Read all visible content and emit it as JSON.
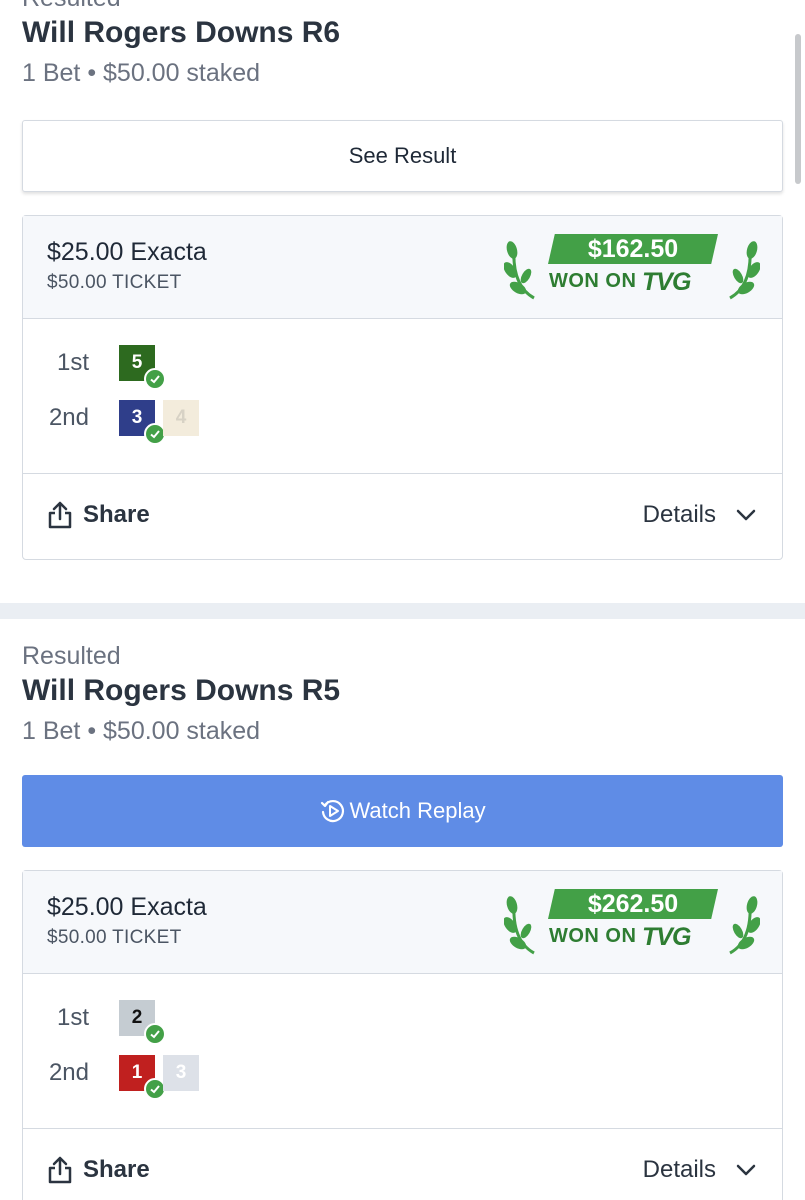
{
  "sections": [
    {
      "status": "Resulted",
      "title": "Will Rogers Downs R6",
      "summary": "1 Bet • $50.00 staked",
      "action_label": "See Result",
      "ticket": {
        "bet": "$25.00 Exacta",
        "ticket_cost": "$50.00 TICKET",
        "won_amount": "$162.50",
        "won_label": "WON ON",
        "won_brand": "TVG",
        "positions": [
          {
            "label": "1st",
            "runners": [
              {
                "number": "5",
                "bg": "#2d6a1f",
                "fg": "#ffffff",
                "winner": true
              }
            ]
          },
          {
            "label": "2nd",
            "runners": [
              {
                "number": "3",
                "bg": "#2f3e8a",
                "fg": "#ffffff",
                "winner": true
              },
              {
                "number": "4",
                "bg": "#f3ecdc",
                "fg": "#d7d2c5",
                "winner": false
              }
            ]
          }
        ],
        "share_label": "Share",
        "details_label": "Details"
      }
    },
    {
      "status": "Resulted",
      "title": "Will Rogers Downs R5",
      "summary": "1 Bet • $50.00 staked",
      "action_label": "Watch Replay",
      "ticket": {
        "bet": "$25.00 Exacta",
        "ticket_cost": "$50.00 TICKET",
        "won_amount": "$262.50",
        "won_label": "WON ON",
        "won_brand": "TVG",
        "positions": [
          {
            "label": "1st",
            "runners": [
              {
                "number": "2",
                "bg": "#c5ccd2",
                "fg": "#111111",
                "winner": true
              }
            ]
          },
          {
            "label": "2nd",
            "runners": [
              {
                "number": "1",
                "bg": "#c0201f",
                "fg": "#ffffff",
                "winner": true
              },
              {
                "number": "3",
                "bg": "#dde1e8",
                "fg": "#ffffff",
                "winner": false
              }
            ]
          }
        ],
        "share_label": "Share",
        "details_label": "Details"
      }
    }
  ],
  "colors": {
    "accent": "#5f8ce6",
    "win_green": "#43a047",
    "divider": "#eaeef3"
  }
}
